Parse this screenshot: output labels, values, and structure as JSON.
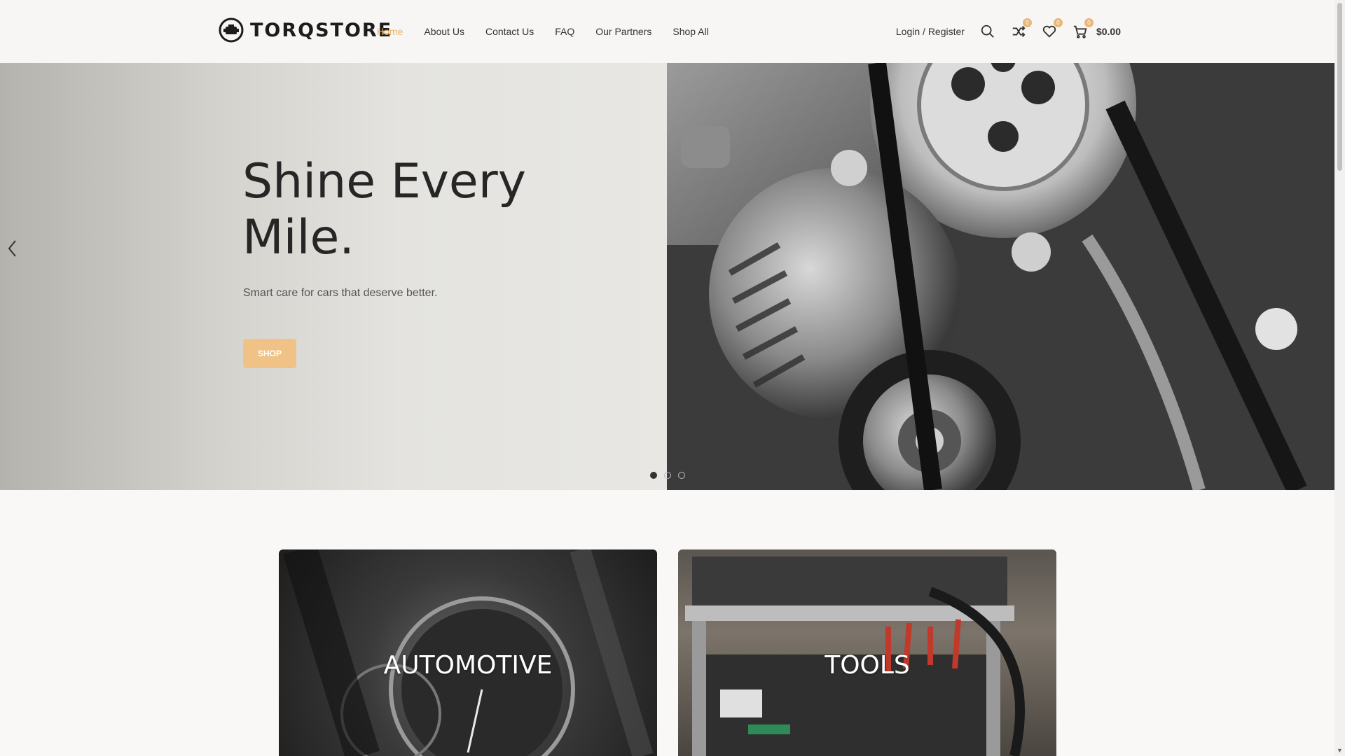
{
  "brand": {
    "name": "TORQSTORE",
    "accent": "#e8b46a"
  },
  "nav": {
    "items": [
      {
        "label": "Home",
        "active": true
      },
      {
        "label": "About Us"
      },
      {
        "label": "Contact Us"
      },
      {
        "label": "FAQ"
      },
      {
        "label": "Our Partners"
      },
      {
        "label": "Shop All"
      }
    ]
  },
  "header": {
    "login_label": "Login / Register",
    "compare_count": "0",
    "wishlist_count": "0",
    "cart_count": "0",
    "cart_total": "$0.00",
    "icons": [
      "search-icon",
      "compare-icon",
      "wishlist-icon",
      "cart-icon"
    ]
  },
  "hero": {
    "title": "Shine Every Mile.",
    "subtitle": "Smart care for cars that deserve better.",
    "button_label": "SHOP",
    "slides": 3,
    "active_slide": 1
  },
  "categories": [
    {
      "label": "AUTOMOTIVE"
    },
    {
      "label": "TOOLS"
    }
  ]
}
